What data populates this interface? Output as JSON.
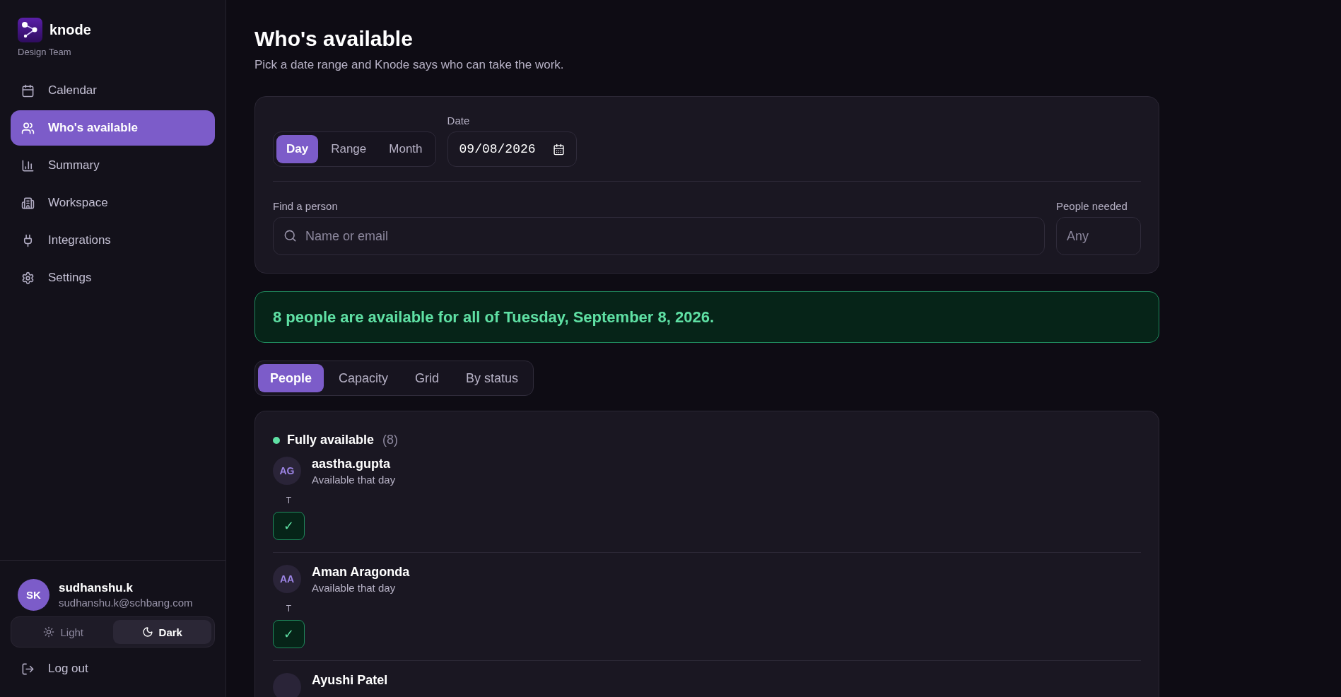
{
  "brand": {
    "name": "knode",
    "team": "Design Team"
  },
  "nav": [
    {
      "label": "Calendar",
      "selected": false
    },
    {
      "label": "Who's available",
      "selected": true
    },
    {
      "label": "Summary",
      "selected": false
    },
    {
      "label": "Workspace",
      "selected": false
    },
    {
      "label": "Integrations",
      "selected": false
    },
    {
      "label": "Settings",
      "selected": false
    }
  ],
  "user": {
    "initials": "SK",
    "name": "sudhanshu.k",
    "email": "sudhanshu.k@schbang.com"
  },
  "theme": [
    {
      "label": "Light",
      "selected": false
    },
    {
      "label": "Dark",
      "selected": true
    }
  ],
  "logout": "Log out",
  "page": {
    "title": "Who's available",
    "subtitle": "Pick a date range and Knode says who can take the work."
  },
  "filters": {
    "modes": [
      {
        "label": "Day",
        "selected": true
      },
      {
        "label": "Range",
        "selected": false
      },
      {
        "label": "Month",
        "selected": false
      }
    ],
    "date_label": "Date",
    "date_value": "09/08/2026",
    "find_label": "Find a person",
    "find_placeholder": "Name or email",
    "needed_label": "People needed",
    "needed_placeholder": "Any"
  },
  "banner": "8 people are available for all of Tuesday, September 8, 2026.",
  "views": [
    {
      "label": "People",
      "selected": true
    },
    {
      "label": "Capacity",
      "selected": false
    },
    {
      "label": "Grid",
      "selected": false
    },
    {
      "label": "By status",
      "selected": false
    }
  ],
  "group": {
    "title": "Fully available",
    "count": "(8)",
    "color": "#5fe0a4",
    "people": [
      {
        "initials": "AG",
        "name": "aastha.gupta",
        "note": "Available that day",
        "days": [
          {
            "label": "T",
            "mark": "✓",
            "available": true
          }
        ]
      },
      {
        "initials": "AA",
        "name": "Aman Aragonda",
        "note": "Available that day",
        "days": [
          {
            "label": "T",
            "mark": "✓",
            "available": true
          }
        ]
      },
      {
        "name": "Ayushi Patel"
      }
    ]
  }
}
